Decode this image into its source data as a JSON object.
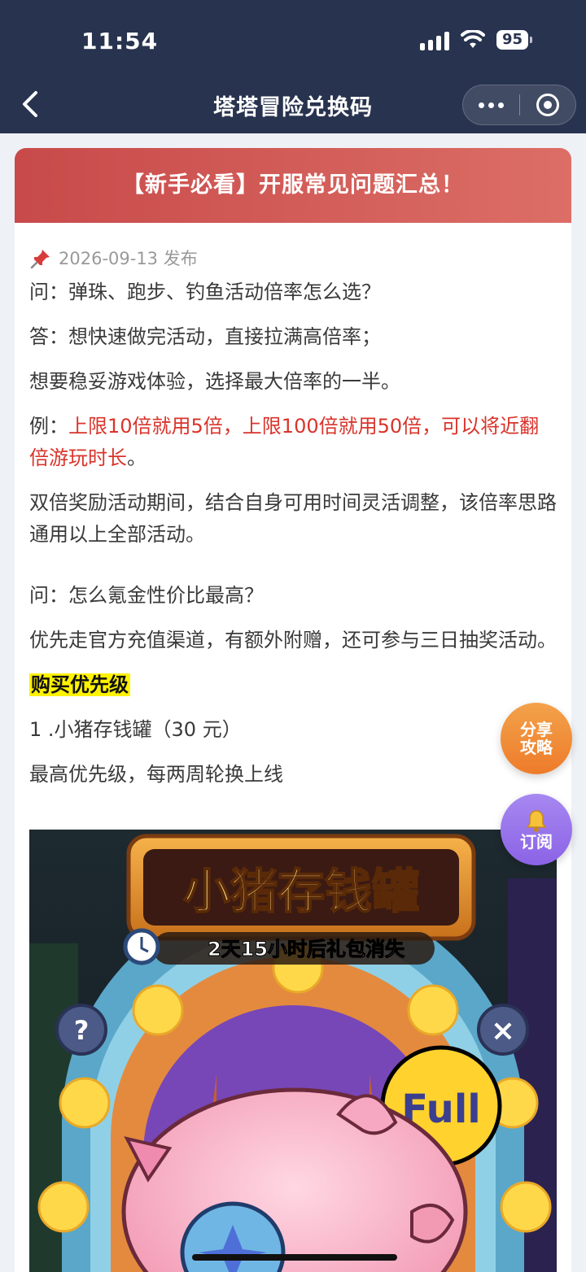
{
  "status_bar": {
    "time": "11:54",
    "battery": "95"
  },
  "nav": {
    "title": "塔塔冒险兑换码"
  },
  "article": {
    "banner": "【新手必看】开服常见问题汇总！",
    "date": "2026-09-13 发布",
    "q1": "问：弹珠、跑步、钓鱼活动倍率怎么选？",
    "a1": "答：想快速做完活动，直接拉满高倍率；",
    "a1b": "想要稳妥游戏体验，选择最大倍率的一半。",
    "example_prefix": "例：",
    "example_red": "上限10倍就用5倍，上限100倍就用50倍，可以将近翻倍游玩时长",
    "example_suffix": "。",
    "double_note": "双倍奖励活动期间，结合自身可用时间灵活调整，该倍率思路通用以上全部活动。",
    "q2": "问：怎么氪金性价比最高？",
    "a2": "优先走官方充值渠道，有额外附赠，还可参与三日抽奖活动。",
    "priority_label": "购买优先级",
    "item1": "1 .小猪存钱罐（30 元）",
    "item1_desc": "最高优先级，每两周轮换上线"
  },
  "game_image": {
    "title": "小猪存钱罐",
    "timer": "2天15小时后礼包消失",
    "full_badge": "Full",
    "help": "?",
    "close": "×"
  },
  "floating": {
    "share": "分享攻略",
    "share_l1": "分享",
    "share_l2": "攻略",
    "subscribe": "订阅"
  },
  "colors": {
    "nav_bg": "#28334f",
    "banner": "#d4594f",
    "red_text": "#d9342b",
    "highlight": "#fff200",
    "share": "#ef852f",
    "subscribe": "#9270e8"
  }
}
